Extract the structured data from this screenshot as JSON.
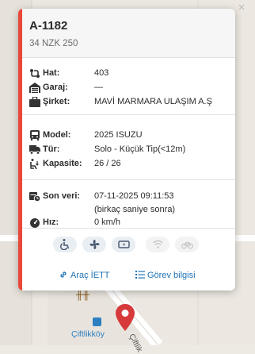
{
  "popup": {
    "close_label": "×",
    "title": "A-1182",
    "plate": "34 NZK 250",
    "route_section": [
      {
        "icon": "route-icon",
        "label": "Hat:",
        "value": "403"
      },
      {
        "icon": "garage-icon",
        "label": "Garaj:",
        "value": "—"
      },
      {
        "icon": "briefcase-icon",
        "label": "Şirket:",
        "value": "MAVİ MARMARA ULAŞIM A.Ş"
      }
    ],
    "vehicle_section": [
      {
        "icon": "bus-icon",
        "label": "Model:",
        "value": "2025 ISUZU"
      },
      {
        "icon": "truck-icon",
        "label": "Tür:",
        "value": "Solo - Küçük Tip(<12m)"
      },
      {
        "icon": "capacity-icon",
        "label": "Kapasite:",
        "value": "26 / 26"
      }
    ],
    "status_section": {
      "last_data_label": "Son veri:",
      "last_data_value": "07-11-2025 09:11:53",
      "last_data_relative": "(birkaç saniye sonra)",
      "speed_label": "Hız:",
      "speed_value": "0 km/h"
    },
    "features": [
      {
        "icon": "wheelchair-icon",
        "active": true
      },
      {
        "icon": "fan-icon",
        "active": true
      },
      {
        "icon": "usb-icon",
        "active": true
      },
      {
        "icon": "wifi-icon",
        "active": false
      },
      {
        "icon": "bicycle-icon",
        "active": false
      }
    ],
    "links": {
      "vehicle_link": "Araç İETT",
      "task_link": "Görev bilgisi"
    }
  },
  "map": {
    "stop_name": "Çiftlikköy",
    "road_name": "Çiftlik",
    "colors": {
      "accent": "#e8473a",
      "link": "#1f73b7",
      "pin": "#d63a3a"
    }
  }
}
